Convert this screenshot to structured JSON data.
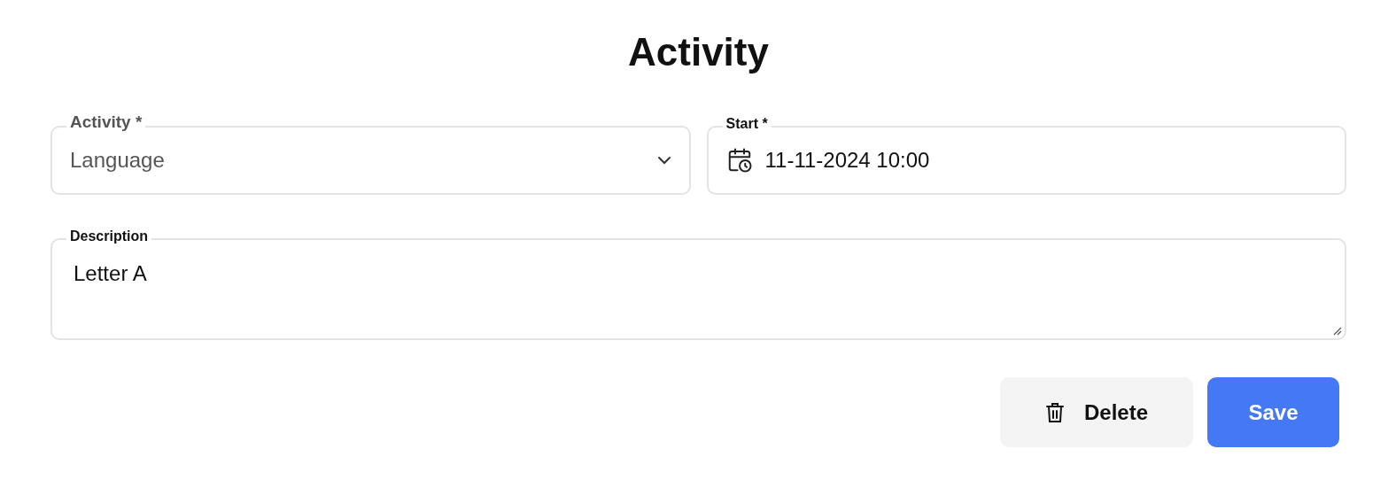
{
  "title": "Activity",
  "fields": [
    {
      "kind": "select",
      "label": "Activity *",
      "value": "Language",
      "muted": true
    },
    {
      "kind": "datetime",
      "label": "Start *",
      "value": "11-11-2024 10:00",
      "muted": false
    }
  ],
  "description": {
    "label": "Description",
    "value": "Letter A"
  },
  "buttons": [
    {
      "kind": "delete",
      "label": "Delete"
    },
    {
      "kind": "primary",
      "label": "Save"
    }
  ]
}
